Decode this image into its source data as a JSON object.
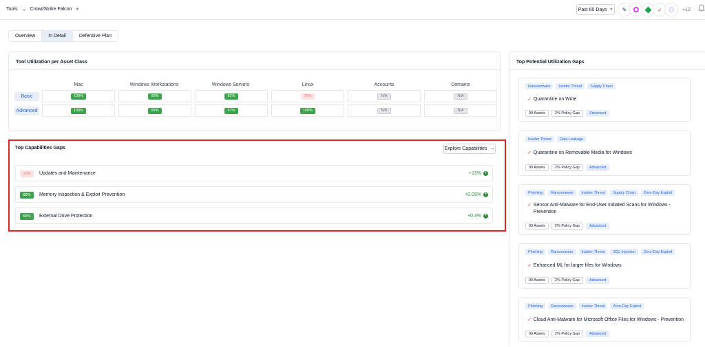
{
  "header": {
    "breadcrumb_root": "Tools",
    "breadcrumb_arrow": "→",
    "tool_name": "CrowdStrike Falcon",
    "date_range": "Past 60 Days",
    "more_integrations": "+12"
  },
  "tabs": [
    {
      "label": "Overview",
      "active": false
    },
    {
      "label": "In Detail",
      "active": true
    },
    {
      "label": "Defensive Plan",
      "active": false
    }
  ],
  "utilization": {
    "title": "Tool Utilization per Asset Class",
    "columns": [
      "Mac",
      "Windows Workstations",
      "Windows Servers",
      "Linux",
      "Accounts",
      "Domains"
    ],
    "rows": [
      {
        "label": "Basic",
        "cells": [
          {
            "value": "100%",
            "style": "green"
          },
          {
            "value": "93%",
            "style": "green"
          },
          {
            "value": "92%",
            "style": "green"
          },
          {
            "value": "75%",
            "style": "pink"
          },
          {
            "value": "N/A",
            "style": "na"
          },
          {
            "value": "N/A",
            "style": "na"
          }
        ]
      },
      {
        "label": "Advanced",
        "cells": [
          {
            "value": "100%",
            "style": "green"
          },
          {
            "value": "99%",
            "style": "green"
          },
          {
            "value": "97%",
            "style": "green"
          },
          {
            "value": "100%",
            "style": "green"
          },
          {
            "value": "N/A",
            "style": "na"
          },
          {
            "value": "N/A",
            "style": "na"
          }
        ]
      }
    ]
  },
  "capabilities": {
    "title": "Top Capabilities Gaps",
    "explore_label": "Explore Capabilities",
    "explore_arrow": "→",
    "items": [
      {
        "percent": "12%",
        "style": "pink",
        "name": "Updates and Maintenance",
        "delta": "+13%"
      },
      {
        "percent": "88%",
        "style": "green",
        "name": "Memory Inspection & Exploit Prevention",
        "delta": "+0.09%"
      },
      {
        "percent": "68%",
        "style": "green",
        "name": "External Drive Protection",
        "delta": "+0.4%"
      }
    ]
  },
  "gaps": {
    "title": "Top Potential Utilization Gaps",
    "items": [
      {
        "tags": [
          "Ransomware",
          "Insider Threat",
          "Supply Chain"
        ],
        "title": "Quarantine on Write",
        "assets": "90 Assets",
        "policy_gap": "2% Policy Gap",
        "level": "Advanced"
      },
      {
        "tags": [
          "Insider Threat",
          "Data Leakage"
        ],
        "title": "Quarantine on Removable Media for Windows",
        "assets": "90 Assets",
        "policy_gap": "2% Policy Gap",
        "level": "Advanced"
      },
      {
        "tags": [
          "Phishing",
          "Ransomware",
          "Insider Threat",
          "Supply Chain",
          "Zero-Day Exploit"
        ],
        "title": "Sensor Anti-Malware for End-User Initiated Scans for Windows - Prevention",
        "assets": "90 Assets",
        "policy_gap": "2% Policy Gap",
        "level": "Advanced"
      },
      {
        "tags": [
          "Phishing",
          "Ransomware",
          "Insider Threat",
          "SQL Injection",
          "Zero-Day Exploit"
        ],
        "title": "Enhanced ML for larger files for Windows",
        "assets": "90 Assets",
        "policy_gap": "2% Policy Gap",
        "level": "Advanced"
      },
      {
        "tags": [
          "Phishing",
          "Ransomware",
          "Insider Threat",
          "Zero-Day Exploit"
        ],
        "title": "Cloud Anti-Malware for Microsoft Office Files for Windows - Prevention",
        "assets": "90 Assets",
        "policy_gap": "2% Policy Gap",
        "level": "Advanced"
      }
    ]
  },
  "colors": {
    "accent": "#2563eb",
    "success": "#3fa34d",
    "danger_highlight": "#dc2626",
    "falcon": "#e0533a"
  }
}
